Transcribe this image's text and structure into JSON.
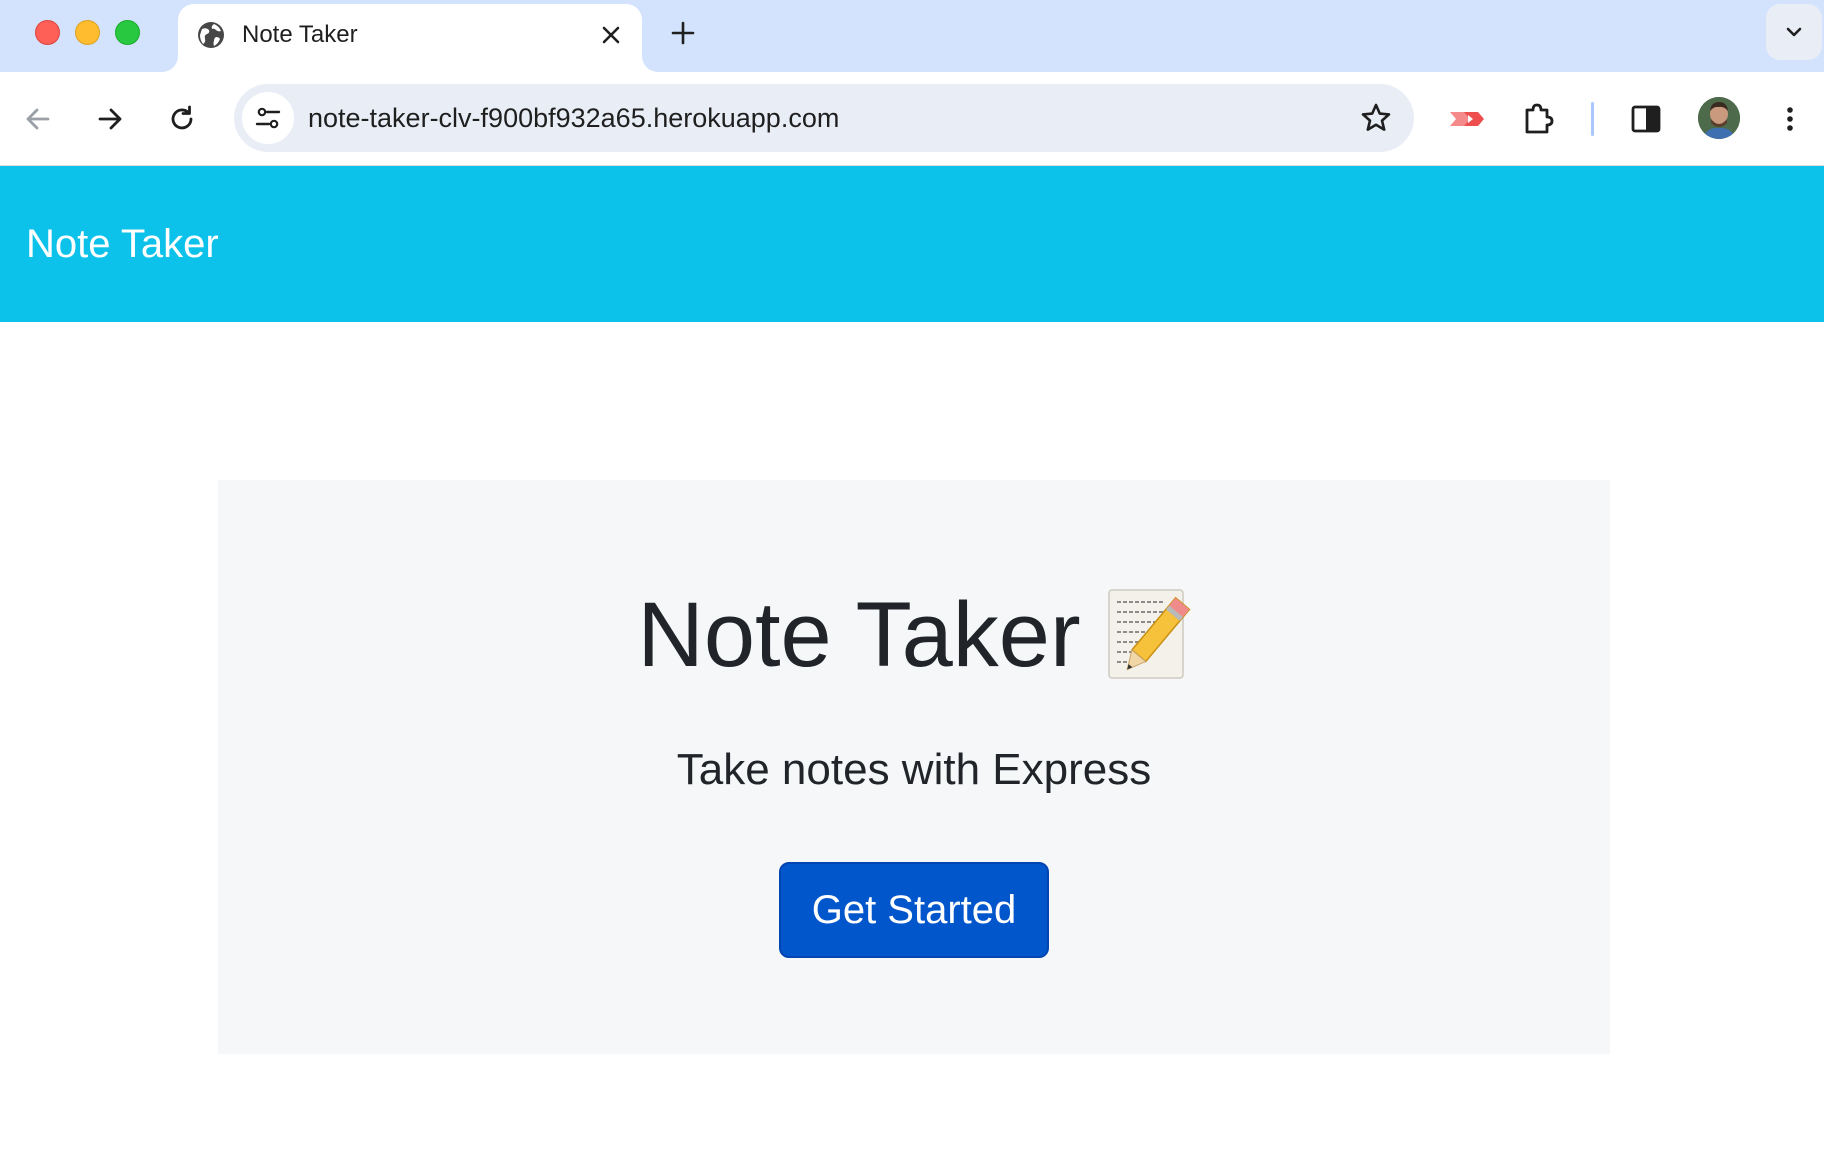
{
  "browser": {
    "tab": {
      "title": "Note Taker",
      "favicon": "globe-icon"
    },
    "new_tab_icon": "plus-icon",
    "tab_search_icon": "chevron-down-icon",
    "address_bar": {
      "url": "note-taker-clv-f900bf932a65.herokuapp.com"
    },
    "icons": [
      "back-arrow-icon",
      "forward-arrow-icon",
      "reload-icon",
      "site-info-icon",
      "star-icon",
      "extension-cast-icon",
      "puzzle-extensions-icon",
      "side-panel-icon",
      "avatar",
      "more-vert-icon"
    ]
  },
  "site": {
    "brand": "Note Taker",
    "header_color": "#0dc2ea"
  },
  "hero": {
    "title": "Note Taker",
    "emoji": "memo-pencil",
    "subtitle": "Take notes with Express",
    "cta_label": "Get Started",
    "cta_color": "#0256cc"
  }
}
